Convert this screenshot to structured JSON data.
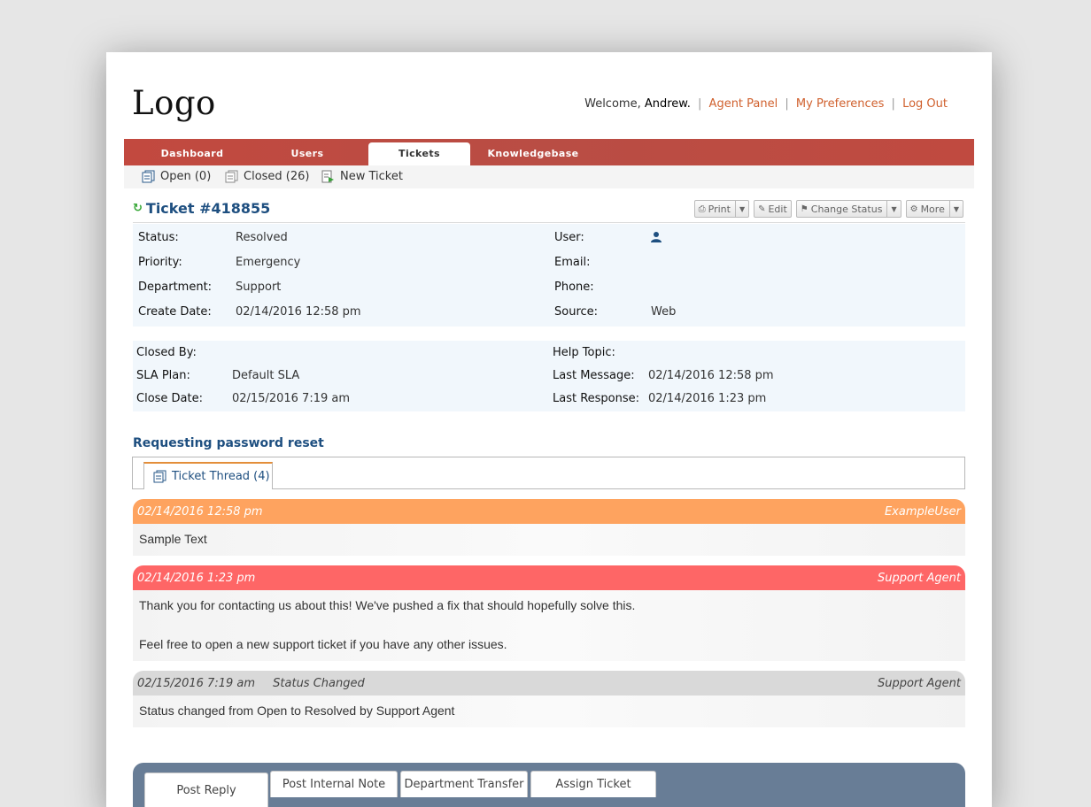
{
  "brand": {
    "logo_text": "Logo"
  },
  "topnav": {
    "welcome_prefix": "Welcome,",
    "user_name": "Andrew.",
    "separator": "|",
    "links": [
      "Agent Panel",
      "My Preferences",
      "Log Out"
    ]
  },
  "main_tabs": [
    "Dashboard",
    "Users",
    "Tickets",
    "Knowledgebase"
  ],
  "active_tab": "Tickets",
  "sub_nav": [
    {
      "label": "Open (0)",
      "icon": "tickets-icon"
    },
    {
      "label": "Closed (26)",
      "icon": "tickets-icon"
    },
    {
      "label": "New Ticket",
      "icon": "new-ticket-icon"
    }
  ],
  "ticket": {
    "title": "Ticket #418855",
    "actions": {
      "print": "Print",
      "edit": "Edit",
      "change_status": "Change Status",
      "more": "More"
    },
    "info_left": [
      {
        "label": "Status:",
        "value": "Resolved"
      },
      {
        "label": "Priority:",
        "value": "Emergency"
      },
      {
        "label": "Department:",
        "value": "Support"
      },
      {
        "label": "Create Date:",
        "value": "02/14/2016 12:58 pm"
      }
    ],
    "info_right": [
      {
        "label": "User:",
        "value": ""
      },
      {
        "label": "Email:",
        "value": ""
      },
      {
        "label": "Phone:",
        "value": ""
      },
      {
        "label": "Source:",
        "value": "Web"
      }
    ],
    "info2_left": [
      {
        "label": "Closed By:",
        "value": ""
      },
      {
        "label": "SLA Plan:",
        "value": "Default SLA"
      },
      {
        "label": "Close Date:",
        "value": "02/15/2016 7:19 am"
      }
    ],
    "info2_right": [
      {
        "label": "Help Topic:",
        "value": ""
      },
      {
        "label": "Last Message:",
        "value": "02/14/2016 12:58 pm"
      },
      {
        "label": "Last Response:",
        "value": "02/14/2016 1:23 pm"
      }
    ],
    "subject": "Requesting password reset",
    "thread_tab": "Ticket Thread (4)"
  },
  "thread": [
    {
      "type": "user",
      "date": "02/14/2016 12:58 pm",
      "author": "ExampleUser",
      "lines": [
        "Sample Text"
      ]
    },
    {
      "type": "agent",
      "date": "02/14/2016 1:23 pm",
      "author": "Support Agent",
      "lines": [
        "Thank you for contacting us about this! We've pushed a fix that should hopefully solve this.",
        "Feel free to open a new support ticket if you have any other issues."
      ]
    },
    {
      "type": "event",
      "date": "02/15/2016 7:19 am",
      "event": "Status Changed",
      "author": "Support Agent",
      "lines": [
        "Status changed from Open to Resolved by Support Agent"
      ]
    }
  ],
  "reply_tabs": [
    "Post Reply",
    "Post Internal Note",
    "Department Transfer",
    "Assign Ticket"
  ],
  "colors": {
    "header_bar": "#c2493f",
    "user_entry": "#fea35f",
    "agent_entry": "#fe6666",
    "event_entry": "#d9d9d9",
    "link": "#d0602d",
    "title_blue": "#1e4f80",
    "reply_bar": "#687d96"
  }
}
